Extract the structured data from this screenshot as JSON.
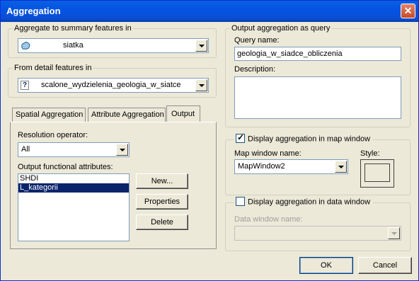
{
  "window": {
    "title": "Aggregation",
    "close_glyph": "✕"
  },
  "aggregate_group": {
    "legend": "Aggregate to summary features in",
    "value": "siatka",
    "icon": "polygon-layer-icon"
  },
  "detail_group": {
    "legend": "From detail features in",
    "value": "scalone_wydzielenia_geologia_w_siatce",
    "icon": "unknown-layer-icon",
    "icon_glyph": "?"
  },
  "tabs": [
    {
      "label": "Spatial Aggregation"
    },
    {
      "label": "Attribute Aggregation"
    },
    {
      "label": "Output"
    }
  ],
  "output_tab": {
    "resolution_label": "Resolution operator:",
    "resolution_value": "All",
    "attributes_label": "Output functional attributes:",
    "attributes": [
      {
        "name": "SHDI",
        "selected": false
      },
      {
        "name": "L_kategorii",
        "selected": true
      }
    ],
    "new_button": "New...",
    "properties_button": "Properties",
    "delete_button": "Delete"
  },
  "query_group": {
    "legend": "Output aggregation as query",
    "query_name_label": "Query name:",
    "query_name_value": "geologia_w_siadce_obliczenia",
    "description_label": "Description:",
    "description_value": ""
  },
  "map_group": {
    "checkbox_label": "Display aggregation in map window",
    "checked": true,
    "map_window_label": "Map window name:",
    "map_window_value": "MapWindow2",
    "style_label": "Style:"
  },
  "data_group": {
    "checkbox_label": "Display aggregation in data window",
    "checked": false,
    "data_window_label": "Data window name:",
    "data_window_value": ""
  },
  "footer": {
    "ok": "OK",
    "cancel": "Cancel"
  }
}
